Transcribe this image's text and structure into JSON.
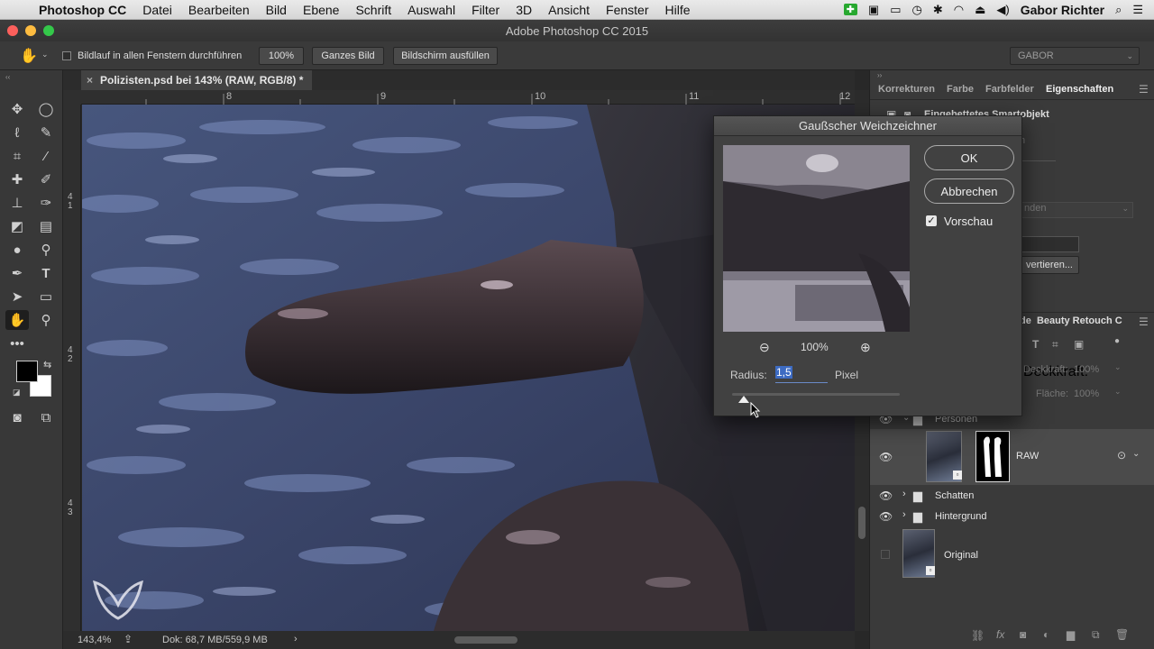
{
  "menubar": {
    "items": [
      "Photoshop CC",
      "Datei",
      "Bearbeiten",
      "Bild",
      "Ebene",
      "Schrift",
      "Auswahl",
      "Filter",
      "3D",
      "Ansicht",
      "Fenster",
      "Hilfe"
    ],
    "user": "Gabor Richter"
  },
  "window": {
    "title": "Adobe Photoshop CC 2015"
  },
  "options": {
    "scroll_all_label": "Bildlauf in allen Fenstern durchführen",
    "zoom_button": "100%",
    "fit_button": "Ganzes Bild",
    "fill_button": "Bildschirm ausfüllen",
    "workspace": "GABOR"
  },
  "document": {
    "tab_title": "Polizisten.psd bei 143% (RAW, RGB/8) *",
    "ruler_h": [
      "8",
      "9",
      "10",
      "11",
      "12"
    ],
    "ruler_v": [
      "4\n1",
      "4\n2",
      "4\n3"
    ]
  },
  "status": {
    "zoom": "143,4%",
    "doc": "Dok: 68,7 MB/559,9 MB"
  },
  "panels": {
    "tabs": [
      "Korrekturen",
      "Farbe",
      "Farbfelder",
      "Eigenschaften"
    ],
    "properties_title": "Eingebettetes Smartobjekt",
    "convert_label": "vertieren...",
    "dropdown_fragment": "nden",
    "layers_tabs_fragment": "de  Beauty Retouch C",
    "opacity_label": "Deckkraft:",
    "opacity_value": "100%",
    "fill_label": "Fläche:",
    "fill_value": "100%"
  },
  "layers": [
    {
      "name": "Personen",
      "type": "group"
    },
    {
      "name": "RAW",
      "type": "smart"
    },
    {
      "name": "Schatten",
      "type": "group"
    },
    {
      "name": "Hintergrund",
      "type": "group"
    },
    {
      "name": "Original",
      "type": "smart"
    }
  ],
  "dialog": {
    "title": "Gaußscher Weichzeichner",
    "ok": "OK",
    "cancel": "Abbrechen",
    "preview_label": "Vorschau",
    "preview_checked": true,
    "zoom": "100%",
    "radius_label": "Radius:",
    "radius_value": "1,5",
    "unit": "Pixel",
    "slider_fraction": 0.07
  },
  "colors": {
    "foreground": "#000000",
    "background": "#ffffff"
  }
}
